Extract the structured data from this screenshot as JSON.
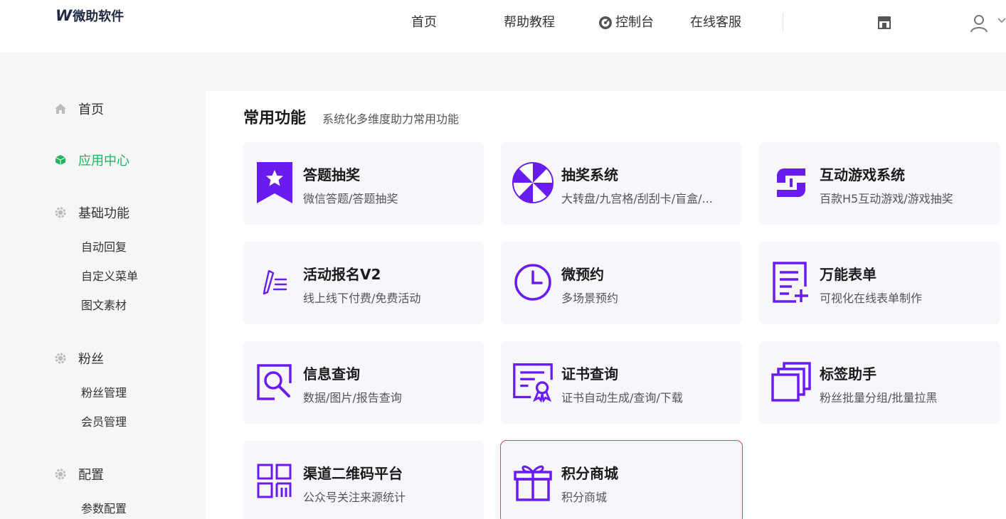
{
  "header": {
    "logo_mark": "W",
    "logo_name": "微助软件",
    "nav": {
      "home": "首页",
      "help": "帮助教程",
      "console": "控制台",
      "service": "在线客服"
    }
  },
  "sidebar": {
    "home": "首页",
    "app_center": "应用中心",
    "basic": {
      "label": "基础功能",
      "items": [
        "自动回复",
        "自定义菜单",
        "图文素材"
      ]
    },
    "fans": {
      "label": "粉丝",
      "items": [
        "粉丝管理",
        "会员管理"
      ]
    },
    "config": {
      "label": "配置",
      "items": [
        "参数配置"
      ]
    }
  },
  "main": {
    "section_title": "常用功能",
    "section_subtitle": "系统化多维度助力常用功能",
    "cards": [
      {
        "title": "答题抽奖",
        "desc": "微信答题/答题抽奖",
        "icon": "star-ribbon-icon"
      },
      {
        "title": "抽奖系统",
        "desc": "大转盘/九宫格/刮刮卡/盲盒/...",
        "icon": "prize-wheel-icon"
      },
      {
        "title": "互动游戏系统",
        "desc": "百款H5互动游戏/游戏抽奖",
        "icon": "link-swap-icon"
      },
      {
        "title": "活动报名V2",
        "desc": "线上线下付费/免费活动",
        "icon": "pen-list-icon"
      },
      {
        "title": "微预约",
        "desc": "多场景预约",
        "icon": "clock-icon"
      },
      {
        "title": "万能表单",
        "desc": "可视化在线表单制作",
        "icon": "form-add-icon"
      },
      {
        "title": "信息查询",
        "desc": "数据/图片/报告查询",
        "icon": "search-doc-icon"
      },
      {
        "title": "证书查询",
        "desc": "证书自动生成/查询/下载",
        "icon": "certificate-icon"
      },
      {
        "title": "标签助手",
        "desc": "粉丝批量分组/批量拉黑",
        "icon": "stacked-tags-icon"
      },
      {
        "title": "渠道二维码平台",
        "desc": "公众号关注来源统计",
        "icon": "qrcode-icon"
      },
      {
        "title": "积分商城",
        "desc": "积分商城",
        "icon": "gift-icon"
      }
    ]
  },
  "colors": {
    "accent_purple": "#6a1bf0",
    "active_green": "#22b35e",
    "selection_red": "#e5444b"
  }
}
